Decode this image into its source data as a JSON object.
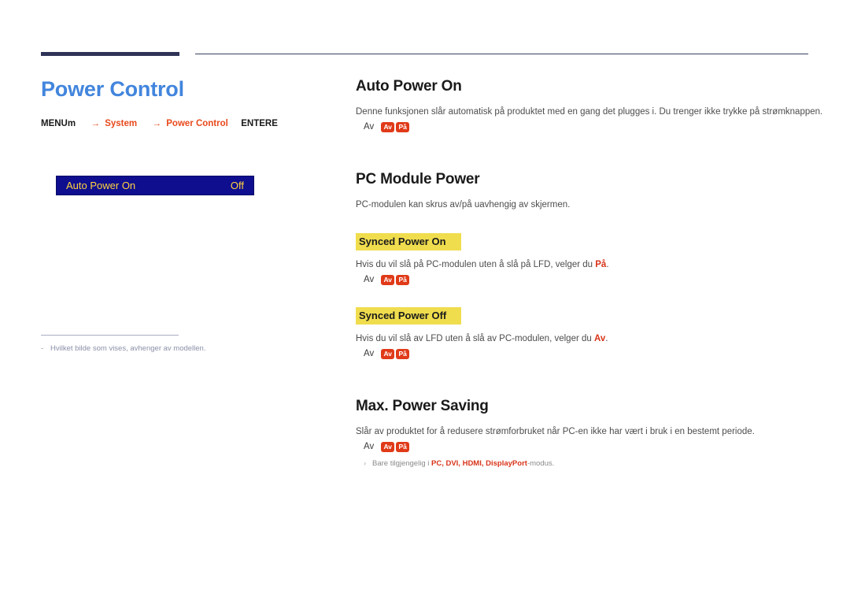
{
  "page": {
    "title": "Power Control"
  },
  "breadcrumb": {
    "menu_key": "MENU",
    "menu_icon": "m",
    "arrow": "→",
    "item1": "System",
    "item2": "Power Control",
    "enter_key": "ENTER",
    "enter_icon": "E"
  },
  "osd": {
    "label": "Auto Power On",
    "value": "Off"
  },
  "left_note": {
    "bullet": "-",
    "text": "Hvilket bilde som vises, avhenger av modellen."
  },
  "sections": [
    {
      "title": "Auto Power On",
      "body": "Denne funksjonen slår automatisk på produktet med en gang det plugges i. Du trenger ikke trykke på strømknappen.",
      "options_label": "Av",
      "options": [
        "Av",
        "På"
      ]
    },
    {
      "title": "PC Module Power",
      "body": "PC-modulen kan skrus av/på uavhengig av skjermen.",
      "subsections": [
        {
          "title": "Synced Power On",
          "body_pre": "Hvis du vil slå på PC-modulen uten å slå på LFD, velger du ",
          "body_strong": "På",
          "body_post": ".",
          "options_label": "Av",
          "options": [
            "Av",
            "På"
          ]
        },
        {
          "title": "Synced Power Off",
          "body_pre": "Hvis du vil slå av LFD uten å slå av PC-modulen, velger du ",
          "body_strong": "Av",
          "body_post": ".",
          "options_label": "Av",
          "options": [
            "Av",
            "På"
          ]
        }
      ]
    },
    {
      "title": "Max. Power Saving",
      "body": "Slår av produktet for å redusere strømforbruket når PC-en ikke har vært i bruk i en bestemt periode.",
      "options_label": "Av",
      "options": [
        "Av",
        "På"
      ],
      "note": {
        "bullet": "›",
        "pre": "Bare tilgjengelig i ",
        "modes": "PC, DVI, HDMI, DisplayPort",
        "post": "-modus."
      }
    }
  ],
  "colors": {
    "title_blue": "#4285dd",
    "breadcrumb_orange": "#e8491c",
    "osd_background": "#0e0e8f",
    "osd_text": "#ffd23f",
    "highlight_yellow": "#f0dd4e",
    "badge_red": "#e03a18",
    "rule_navy": "#2f3357"
  }
}
